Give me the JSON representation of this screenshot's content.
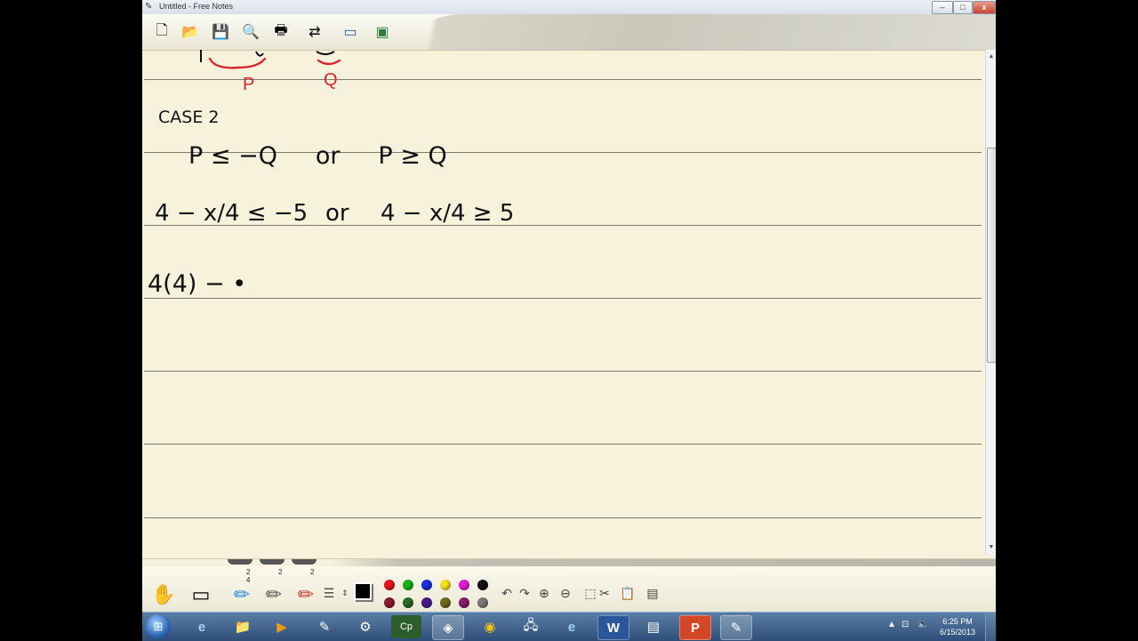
{
  "window": {
    "title": "Untitled - Free Notes",
    "minimize_label": "–",
    "maximize_label": "□",
    "close_label": "x"
  },
  "toolbar": {
    "buttons": [
      {
        "name": "new",
        "glyph": "🗋"
      },
      {
        "name": "open",
        "glyph": "📂"
      },
      {
        "name": "save",
        "glyph": "💾"
      },
      {
        "name": "preview",
        "glyph": "🔍"
      },
      {
        "name": "print",
        "glyph": "🖶"
      },
      {
        "name": "scan",
        "glyph": "⇄"
      },
      {
        "name": "window",
        "glyph": "▭"
      },
      {
        "name": "screen",
        "glyph": "▣"
      }
    ]
  },
  "notes": {
    "case_label": "CASE 2",
    "p_label": "P",
    "q_label": "Q",
    "line1": "P ≤ −Q     or     P ≥ Q",
    "line2_left": "4 − x/4 ≤ −5",
    "line2_or": "or",
    "line2_right": "4 − x/4 ≥ 5",
    "line3": "4(4) − •"
  },
  "pens": {
    "sizes": [
      "2",
      "2",
      "2"
    ],
    "active_extra": "4"
  },
  "palette": {
    "top": [
      "#e8141a",
      "#19b21a",
      "#1a2fe0",
      "#f2e31a",
      "#e61ad7",
      "#111111"
    ],
    "bottom": [
      "#8a1a2e",
      "#2a6a2a",
      "#4b1a8a",
      "#6f6a1a",
      "#8a1a6a",
      "#7a7a7a"
    ]
  },
  "taskbar": {
    "apps": [
      {
        "name": "ie",
        "glyph": "e"
      },
      {
        "name": "explorer",
        "glyph": "📁"
      },
      {
        "name": "media",
        "glyph": "▶"
      },
      {
        "name": "freenotes",
        "glyph": "✎"
      },
      {
        "name": "app-5",
        "glyph": "⚙"
      },
      {
        "name": "captivate",
        "glyph": "Cp"
      },
      {
        "name": "app-7",
        "glyph": "◈"
      },
      {
        "name": "chrome",
        "glyph": "◉"
      },
      {
        "name": "network",
        "glyph": "🖧"
      },
      {
        "name": "ie-2",
        "glyph": "e"
      },
      {
        "name": "word",
        "glyph": "W"
      },
      {
        "name": "app-12",
        "glyph": "▤"
      },
      {
        "name": "powerpoint",
        "glyph": "P"
      },
      {
        "name": "freenotes-2",
        "glyph": "✎"
      }
    ],
    "time": "6:25 PM",
    "date": "6/15/2013"
  }
}
